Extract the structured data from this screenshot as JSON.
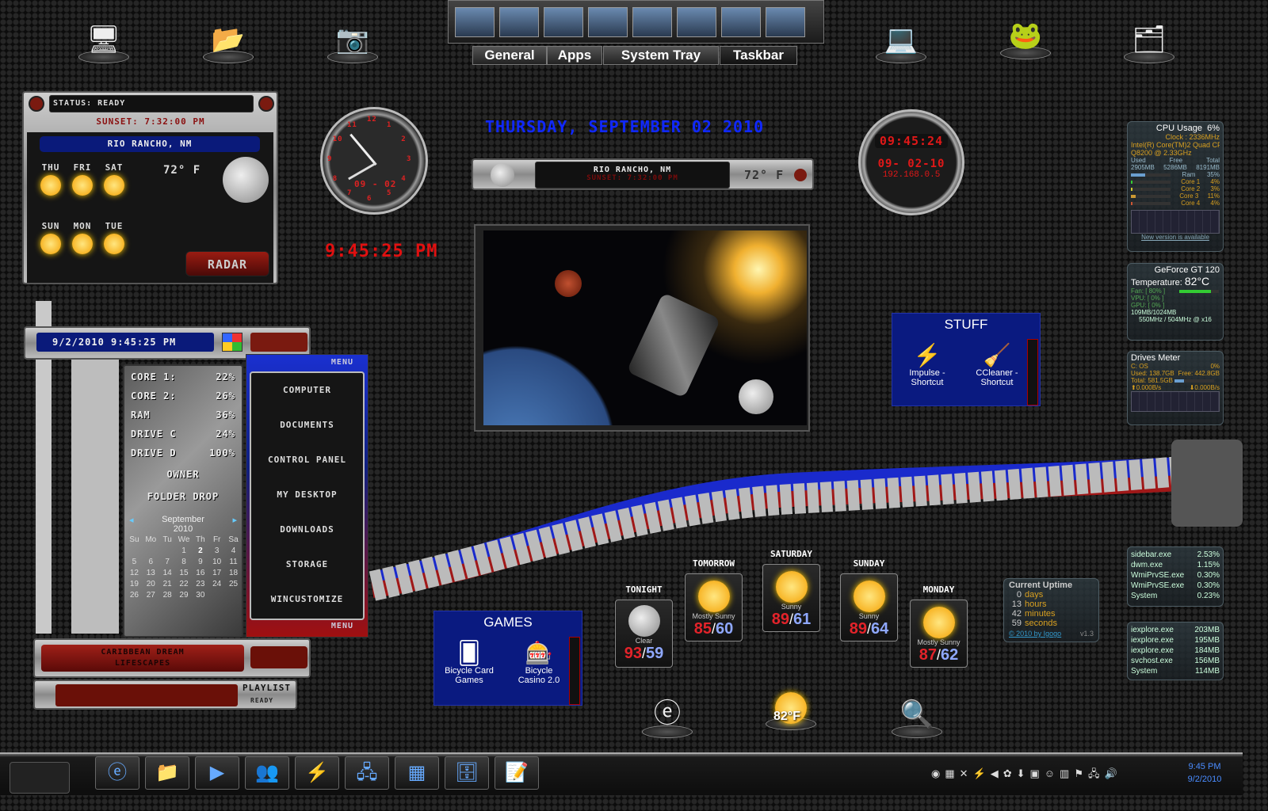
{
  "dock": {
    "left": [
      "computer",
      "folder",
      "camera"
    ],
    "right": [
      "laptop",
      "frog-mascot",
      "folder-dark"
    ]
  },
  "top_tabs": {
    "thumbnails": [
      "messenger",
      "network",
      "window",
      "monitor",
      "explorer",
      "cabinet",
      "taskmgr",
      "notepad"
    ],
    "tabs": [
      "General",
      "Apps",
      "System Tray",
      "Taskbar"
    ],
    "active": "Taskbar"
  },
  "weather_widget": {
    "status": "STATUS: READY",
    "sunset": "SUNSET: 7:32:00 PM",
    "location": "RIO RANCHO, NM",
    "temp": "72° F",
    "days": [
      "THU",
      "FRI",
      "SAT",
      "SUN",
      "MON",
      "TUE"
    ],
    "radar": "RADAR"
  },
  "clock": {
    "digital": "9:45:25 PM",
    "analog_numbers": [
      "12",
      "1",
      "2",
      "3",
      "4",
      "5",
      "6",
      "7",
      "8",
      "9",
      "10",
      "11"
    ],
    "analog_date": "09 - 02"
  },
  "date_banner": "THURSDAY, SEPTEMBER 02 2010",
  "weather_bar": {
    "location": "RIO RANCHO, NM",
    "sunset": "SUNSET: 7:32:00 PM",
    "temp": "72° F"
  },
  "digital_clock": {
    "time": "09:45:24",
    "date": "09- 02-10",
    "ip": "192.168.0.5"
  },
  "stuff": {
    "title": "STUFF",
    "items": [
      "Impulse - Shortcut",
      "CCleaner - Shortcut"
    ]
  },
  "games": {
    "title": "GAMES",
    "items": [
      "Bicycle Card Games",
      "Bicycle Casino 2.0"
    ]
  },
  "forecast": [
    {
      "day": "TONIGHT",
      "cond": "Clear",
      "hi": "93",
      "lo": "59"
    },
    {
      "day": "TOMORROW",
      "cond": "Mostly Sunny",
      "hi": "85",
      "lo": "60"
    },
    {
      "day": "SATURDAY",
      "cond": "Sunny",
      "hi": "89",
      "lo": "61"
    },
    {
      "day": "SUNDAY",
      "cond": "Sunny",
      "hi": "89",
      "lo": "64"
    },
    {
      "day": "MONDAY",
      "cond": "Mostly Sunny",
      "hi": "87",
      "lo": "62"
    }
  ],
  "bottom_dock": {
    "weather_temp": "82°F"
  },
  "cpu": {
    "title": "CPU Usage",
    "usage": "6%",
    "clock": "Clock : 2336MHz",
    "model": "Intel(R) Core(TM)2 Quad CPU",
    "model2": "Q8200 @ 2.33GHz",
    "headers": [
      "Used",
      "Free",
      "Total"
    ],
    "mem": [
      "2905MB",
      "5286MB",
      "8191MB"
    ],
    "rows": [
      {
        "label": "Ram",
        "value": "35%",
        "pct": 35
      },
      {
        "label": "Core 1",
        "value": "4%",
        "pct": 4
      },
      {
        "label": "Core 2",
        "value": "3%",
        "pct": 3
      },
      {
        "label": "Core 3",
        "value": "11%",
        "pct": 11
      },
      {
        "label": "Core 4",
        "value": "4%",
        "pct": 4
      }
    ],
    "link": "New version is available"
  },
  "gpu": {
    "title": "GeForce GT 120",
    "temp_label": "Temperature:",
    "temp": "82°C",
    "fan": "Fan: [ 80% ]",
    "fan_pct": 80,
    "vpu": "VPU: [ 0% ]",
    "gpu": "GPU: [ 0% ]",
    "mem": "109MB/1024MB",
    "clocks": "550MHz / 504MHz @ x16"
  },
  "drives": {
    "title": "Drives Meter",
    "drive": "C: OS",
    "pct": "0%",
    "used": "Used: 138.7GB",
    "free": "Free: 442.8GB",
    "total": "Total: 581.5GB",
    "up": "0.000B/s",
    "down": "0.000B/s",
    "used_pct": 24
  },
  "cpu_procs": [
    [
      "sidebar.exe",
      "2.53%"
    ],
    [
      "dwm.exe",
      "1.15%"
    ],
    [
      "WmiPrvSE.exe",
      "0.30%"
    ],
    [
      "WmiPrvSE.exe",
      "0.30%"
    ],
    [
      "System",
      "0.23%"
    ]
  ],
  "mem_procs": [
    [
      "iexplore.exe",
      "203MB"
    ],
    [
      "iexplore.exe",
      "195MB"
    ],
    [
      "iexplore.exe",
      "184MB"
    ],
    [
      "svchost.exe",
      "156MB"
    ],
    [
      "System",
      "114MB"
    ]
  ],
  "uptime": {
    "title": "Current Uptime",
    "rows": [
      [
        "0",
        "days"
      ],
      [
        "13",
        "hours"
      ],
      [
        "42",
        "minutes"
      ],
      [
        "59",
        "seconds"
      ]
    ],
    "link": "© 2010 by Igogo",
    "version": "v1.3"
  },
  "sys_panel": {
    "datetime": "9/2/2010 9:45:25 PM",
    "stats": [
      [
        "CORE 1:",
        "22%"
      ],
      [
        "CORE 2:",
        "26%"
      ],
      [
        "RAM",
        "36%"
      ],
      [
        "DRIVE C",
        "24%"
      ],
      [
        "DRIVE D",
        "100%"
      ]
    ],
    "owner": "OWNER",
    "folder_drop": "FOLDER DROP",
    "calendar": {
      "month": "September",
      "year": "2010",
      "weekdays": [
        "Su",
        "Mo",
        "Tu",
        "We",
        "Th",
        "Fr",
        "Sa"
      ],
      "weeks": [
        [
          "",
          "",
          "",
          "1",
          "2",
          "3",
          "4"
        ],
        [
          "5",
          "6",
          "7",
          "8",
          "9",
          "10",
          "11"
        ],
        [
          "12",
          "13",
          "14",
          "15",
          "16",
          "17",
          "18"
        ],
        [
          "19",
          "20",
          "21",
          "22",
          "23",
          "24",
          "25"
        ],
        [
          "26",
          "27",
          "28",
          "29",
          "30",
          "",
          ""
        ]
      ],
      "today": "2"
    }
  },
  "menu": {
    "title": "MENU",
    "items": [
      "COMPUTER",
      "DOCUMENTS",
      "CONTROL PANEL",
      "MY DESKTOP",
      "DOWNLOADS",
      "STORAGE",
      "WINCUSTOMIZE"
    ],
    "footer": "MENU"
  },
  "player": {
    "track1": "CARIBBEAN DREAM",
    "track2": "LIFESCAPES",
    "playlist": "PLAYLIST",
    "status": "READY"
  },
  "taskbar": {
    "apps": [
      "internet-explorer",
      "file-explorer",
      "media-player",
      "messenger",
      "impulse",
      "network",
      "control-panel",
      "cabinet",
      "notepad"
    ],
    "time": "9:45 PM",
    "date": "9/2/2010"
  }
}
